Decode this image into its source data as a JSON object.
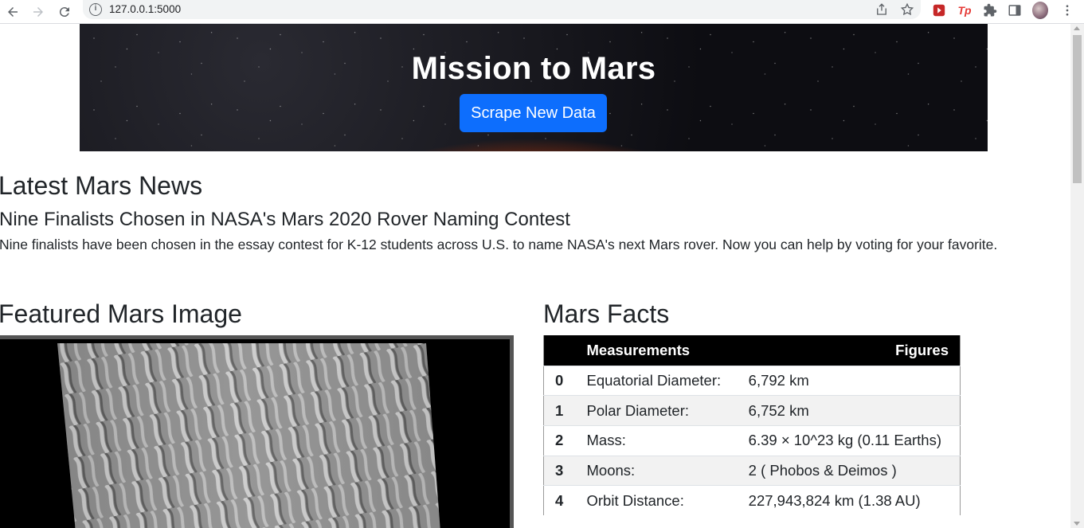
{
  "browser": {
    "url": "127.0.0.1:5000",
    "info_glyph": "i"
  },
  "hero": {
    "title": "Mission to Mars",
    "scrape_button": "Scrape New Data",
    "button_color": "#0d6efd"
  },
  "news": {
    "heading": "Latest Mars News",
    "title": "Nine Finalists Chosen in NASA's Mars 2020 Rover Naming Contest",
    "paragraph": "Nine finalists have been chosen in the essay contest for K-12 students across U.S. to name NASA's next Mars rover. Now you can help by voting for your favorite."
  },
  "featured": {
    "heading": "Featured Mars Image"
  },
  "facts": {
    "heading": "Mars Facts",
    "columns": [
      "",
      "Measurements",
      "Figures"
    ],
    "rows": [
      {
        "idx": "0",
        "measure": "Equatorial Diameter:",
        "figure": "6,792 km"
      },
      {
        "idx": "1",
        "measure": "Polar Diameter:",
        "figure": "6,752 km"
      },
      {
        "idx": "2",
        "measure": "Mass:",
        "figure": "6.39 × 10^23 kg (0.11 Earths)"
      },
      {
        "idx": "3",
        "measure": "Moons:",
        "figure": "2 ( Phobos & Deimos )"
      },
      {
        "idx": "4",
        "measure": "Orbit Distance:",
        "figure": "227,943,824 km (1.38 AU)"
      }
    ]
  }
}
